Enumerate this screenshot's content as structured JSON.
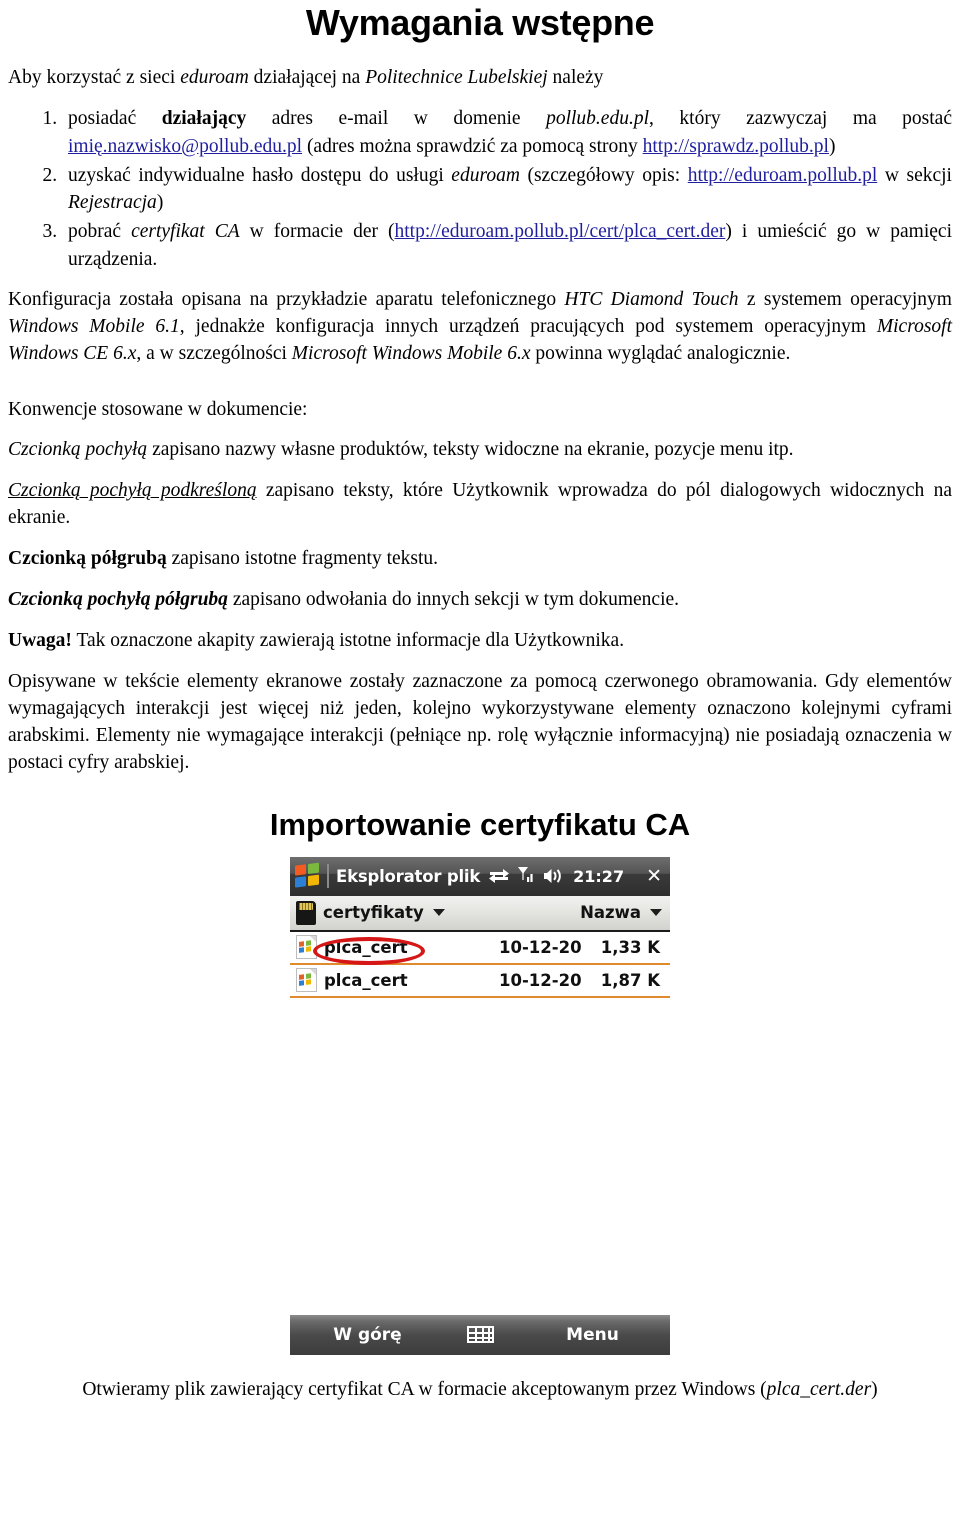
{
  "document": {
    "title": "Wymagania wstępne",
    "lead": {
      "pre": "Aby korzystać z sieci ",
      "em1": "eduroam",
      "mid": " działającej na ",
      "em2": "Politechnice Lubelskiej",
      "post": " należy"
    },
    "requirements": [
      {
        "index": "1.",
        "p1": "posiadać ",
        "strong": "działający",
        "p2": " adres e-mail w domenie ",
        "em": "pollub.edu.pl",
        "p3": ", który zazwyczaj ma postać ",
        "link1": "imię.nazwisko@pollub.edu.pl",
        "p4": " (adres można sprawdzić za pomocą strony ",
        "link2": "http://sprawdz.pollub.pl",
        "p5": ")"
      },
      {
        "index": "2.",
        "p1": "uzyskać indywidualne hasło dostępu do usługi ",
        "em": "eduroam",
        "p2": " (szczegółowy opis: ",
        "link1": "http://eduroam.pollub.pl",
        "p3": " w sekcji ",
        "em2": "Rejestracja",
        "p4": ")"
      },
      {
        "index": "3.",
        "p1": "pobrać ",
        "em": "certyfikat CA",
        "p2": " w formacie der (",
        "link1": "http://eduroam.pollub.pl/cert/plca_cert.der",
        "p3": ") i umieścić go w pamięci urządzenia."
      }
    ],
    "paragraphs": {
      "config": {
        "t1": "Konfiguracja została opisana na przykładzie aparatu telefonicznego ",
        "em1": "HTC Diamond Touch",
        "t2": " z systemem operacyjnym ",
        "em2": "Windows Mobile 6.1",
        "t3": ", jednakże konfiguracja innych urządzeń pracujących pod systemem operacyjnym ",
        "em3": "Microsoft Windows CE 6.x",
        "t4": ", a w szczególności ",
        "em4": "Microsoft Windows Mobile 6.x",
        "t5": " powinna wyglądać analogicznie."
      },
      "conventions_heading": "Konwencje stosowane w dokumencie:",
      "conv_italic": {
        "em": "Czcionką pochyłą",
        "rest": " zapisano nazwy własne produktów, teksty widoczne na ekranie, pozycje menu itp."
      },
      "conv_italic_underline": {
        "em": "Czcionką pochyłą podkreśloną",
        "rest": " zapisano teksty, które Użytkownik wprowadza do pól dialogowych widocznych na ekranie."
      },
      "conv_bold": {
        "em": "Czcionką półgrubą",
        "rest": " zapisano istotne fragmenty tekstu."
      },
      "conv_bold_italic": {
        "em": "Czcionką pochyłą półgrubą",
        "rest": " zapisano odwołania do innych sekcji w tym dokumencie."
      },
      "notice": {
        "em": "Uwaga!",
        "rest": " Tak oznaczone akapity zawierają istotne informacje dla Użytkownika."
      },
      "marking": "Opisywane w tekście elementy ekranowe zostały zaznaczone za pomocą czerwonego obramowania. Gdy elementów wymagających interakcji jest więcej niż jeden, kolejno wykorzystywane elementy oznaczono kolejnymi cyframi arabskimi. Elementy nie wymagające interakcji (pełniące np. rolę wyłącznie informacyjną) nie posiadają oznaczenia w postaci cyfry arabskiej."
    },
    "section_title": "Importowanie certyfikatu CA",
    "caption": {
      "t1": "Otwieramy plik zawierający certyfikat CA w formacie akceptowanym przez Windows (",
      "em": "plca_cert.der",
      "t2": ")"
    }
  },
  "screenshot": {
    "titlebar": {
      "app_title": "Eksplorator plik",
      "time": "21:27",
      "close": "✕",
      "icons": [
        "sync-arrows-icon",
        "signal-strength-icon",
        "volume-icon"
      ]
    },
    "pathbar": {
      "folder": "certyfikaty",
      "sort_label": "Nazwa"
    },
    "files": [
      {
        "name": "plca_cert",
        "date": "10-12-20",
        "size": "1,33 K",
        "highlighted": true
      },
      {
        "name": "plca_cert",
        "date": "10-12-20",
        "size": "1,87 K",
        "highlighted": false
      }
    ],
    "softkeys": {
      "left": "W górę",
      "right": "Menu",
      "middle_icon": "keyboard-icon"
    },
    "colors": {
      "annotation_red": "#d51717",
      "row_separator": "#e08a2e",
      "link_blue": "#1f1f9e"
    }
  }
}
